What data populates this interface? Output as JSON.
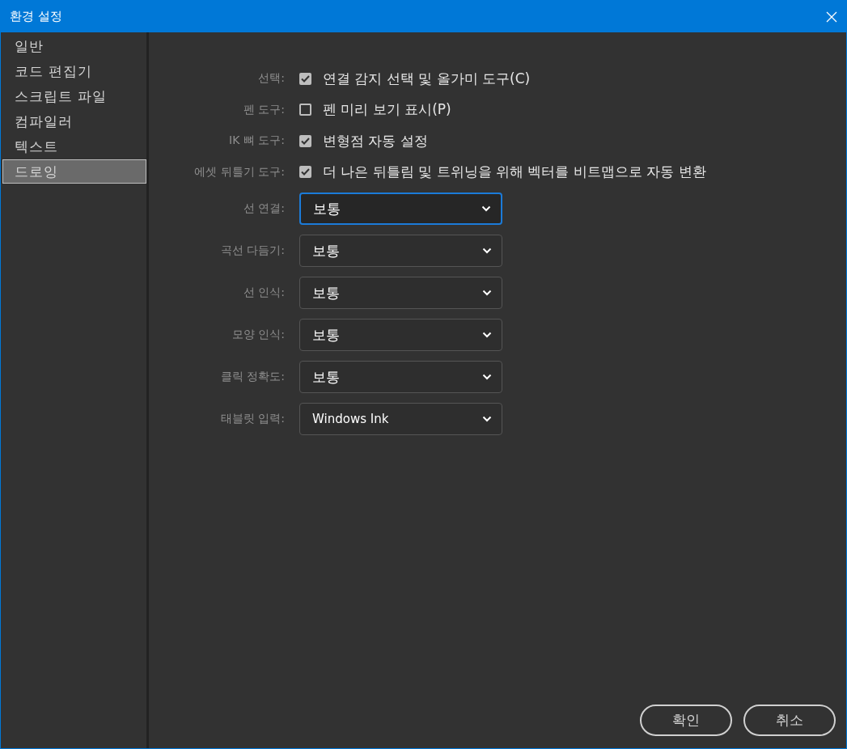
{
  "window": {
    "title": "환경 설정"
  },
  "sidebar": {
    "items": [
      {
        "label": "일반",
        "selected": false
      },
      {
        "label": "코드 편집기",
        "selected": false
      },
      {
        "label": "스크립트 파일",
        "selected": false
      },
      {
        "label": "컴파일러",
        "selected": false
      },
      {
        "label": "텍스트",
        "selected": false
      },
      {
        "label": "드로잉",
        "selected": true
      }
    ]
  },
  "settings": [
    {
      "kind": "checkbox",
      "label": "선택:",
      "text": "연결 감지 선택 및 올가미 도구(C)",
      "checked": true
    },
    {
      "kind": "checkbox",
      "label": "펜 도구:",
      "text": "펜 미리 보기 표시(P)",
      "checked": false
    },
    {
      "kind": "checkbox",
      "label": "IK 뼈 도구:",
      "text": "변형점 자동 설정",
      "checked": true
    },
    {
      "kind": "checkbox",
      "label": "에셋 뒤틀기 도구:",
      "text": "더 나은 뒤틀림 및 트위닝을 위해 벡터를 비트맵으로 자동 변환",
      "checked": true
    },
    {
      "kind": "select",
      "label": "선 연결:",
      "value": "보통",
      "focused": true
    },
    {
      "kind": "select",
      "label": "곡선 다듬기:",
      "value": "보통",
      "focused": false
    },
    {
      "kind": "select",
      "label": "선 인식:",
      "value": "보통",
      "focused": false
    },
    {
      "kind": "select",
      "label": "모양 인식:",
      "value": "보통",
      "focused": false
    },
    {
      "kind": "select",
      "label": "클릭 정확도:",
      "value": "보통",
      "focused": false
    },
    {
      "kind": "select",
      "label": "태블릿 입력:",
      "value": "Windows Ink",
      "focused": false
    }
  ],
  "buttons": [
    "확인",
    "취소"
  ]
}
